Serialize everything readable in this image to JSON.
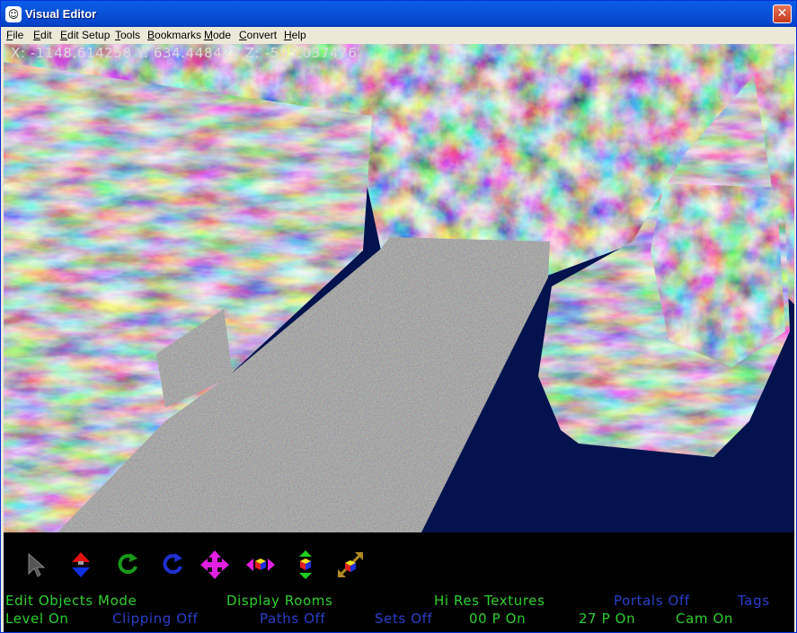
{
  "window": {
    "title": "Visual Editor",
    "app_icon_glyph": "☺",
    "close_glyph": "✕"
  },
  "menu": [
    {
      "label": "File",
      "accel": "F",
      "rest": "ile"
    },
    {
      "label": "Edit",
      "accel": "E",
      "rest": "dit"
    },
    {
      "label": "Edit Setup",
      "accel": "E",
      "rest": "dit Setup"
    },
    {
      "label": "Tools",
      "accel": "T",
      "rest": "ools"
    },
    {
      "label": "Bookmarks",
      "accel": "B",
      "rest": "ookmarks"
    },
    {
      "label": "Mode",
      "accel": "M",
      "rest": "ode"
    },
    {
      "label": "Convert",
      "accel": "C",
      "rest": "onvert"
    },
    {
      "label": "Help",
      "accel": "H",
      "rest": "elp"
    }
  ],
  "viewport": {
    "coords": "X: -1148.614258 Y: 634.448425 Z: -595.037476",
    "background_color": "#04134e"
  },
  "tools": [
    {
      "name": "select-arrow-icon"
    },
    {
      "name": "move-vertical-icon"
    },
    {
      "name": "rotate-green-icon"
    },
    {
      "name": "rotate-blue-icon"
    },
    {
      "name": "move-cross-icon"
    },
    {
      "name": "move-horizontal-cube-icon"
    },
    {
      "name": "move-vertical-cube-icon"
    },
    {
      "name": "move-diagonal-cube-icon"
    }
  ],
  "status": {
    "row1": [
      {
        "text": "Edit Objects Mode",
        "color": "#2ed02e"
      },
      {
        "text": "Display Rooms",
        "color": "#2ed02e"
      },
      {
        "text": "Hi Res Textures",
        "color": "#2ed02e"
      },
      {
        "text": "Portals Off",
        "color": "#2b3fc8"
      },
      {
        "text": "Tags",
        "color": "#2b3fc8"
      }
    ],
    "row2": [
      {
        "text": "Level On",
        "color": "#2ed02e"
      },
      {
        "text": "Clipping Off",
        "color": "#2b3fc8"
      },
      {
        "text": "Paths Off",
        "color": "#2b3fc8"
      },
      {
        "text": "Sets Off",
        "color": "#2b3fc8"
      },
      {
        "text": "00 P On",
        "color": "#2ed02e"
      },
      {
        "text": "27 P On",
        "color": "#2ed02e"
      },
      {
        "text": "Cam On",
        "color": "#2ed02e"
      }
    ]
  }
}
